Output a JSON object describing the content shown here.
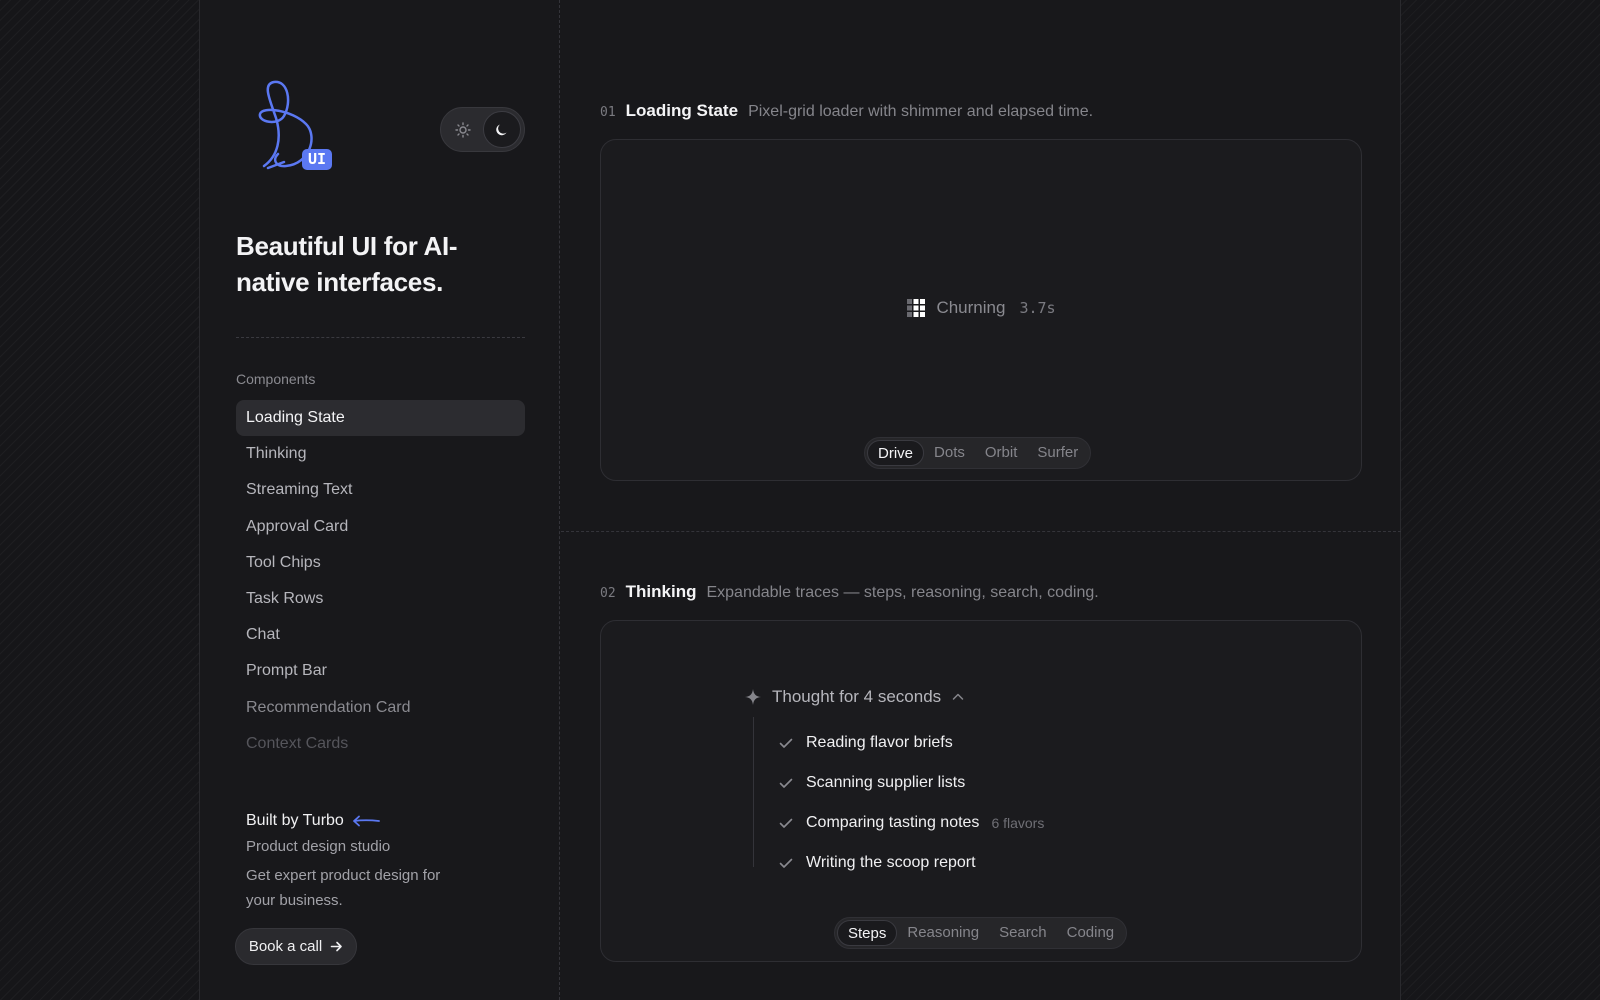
{
  "brand": {
    "logo_letter": "B",
    "logo_badge": "UI",
    "accent": "#5b78f2"
  },
  "theme_toggle": {
    "light_icon": "sun-icon",
    "dark_icon": "moon-icon",
    "selected": "dark"
  },
  "tagline": "Beautiful UI for AI-native interfaces.",
  "sidebar": {
    "section_label": "Components",
    "items": [
      {
        "label": "Loading State"
      },
      {
        "label": "Thinking"
      },
      {
        "label": "Streaming Text"
      },
      {
        "label": "Approval Card"
      },
      {
        "label": "Tool Chips"
      },
      {
        "label": "Task Rows"
      },
      {
        "label": "Chat"
      },
      {
        "label": "Prompt Bar"
      },
      {
        "label": "Recommendation Card"
      },
      {
        "label": "Context Cards"
      }
    ],
    "active_index": 0
  },
  "promo": {
    "title": "Built by Turbo",
    "subtitle": "Product design studio",
    "text": "Get expert product design for your business.",
    "cta_label": "Book a call"
  },
  "sections": [
    {
      "number": "01",
      "title": "Loading State",
      "description": "Pixel-grid loader with shimmer and elapsed time.",
      "loader_text": "Churning",
      "elapsed": "3.7s",
      "variants": [
        "Drive",
        "Dots",
        "Orbit",
        "Surfer"
      ],
      "active_variant": "Drive"
    },
    {
      "number": "02",
      "title": "Thinking",
      "description": "Expandable traces — steps, reasoning, search, coding.",
      "trace_title": "Thought for 4 seconds",
      "steps": [
        {
          "label": "Reading flavor briefs",
          "note": ""
        },
        {
          "label": "Scanning supplier lists",
          "note": ""
        },
        {
          "label": "Comparing tasting notes",
          "note": "6 flavors"
        },
        {
          "label": "Writing the scoop report",
          "note": ""
        }
      ],
      "variants": [
        "Steps",
        "Reasoning",
        "Search",
        "Coding"
      ],
      "active_variant": "Steps"
    }
  ]
}
